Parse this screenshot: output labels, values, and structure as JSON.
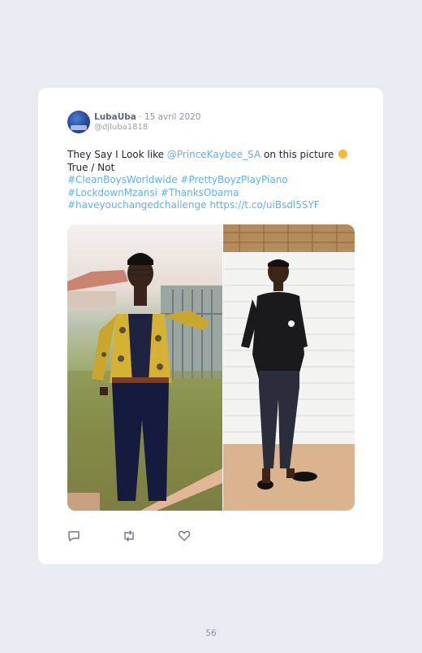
{
  "tweet": {
    "author_name": "LubaUba",
    "separator": " · ",
    "date": "15 avril 2020",
    "handle": "@djluba1818",
    "text_prefix": "They Say I Look like ",
    "mention": "@PrinceKaybee_SA",
    "text_suffix": " on this picture ",
    "line2": "True / Not",
    "hashtags_line1": "#CleanBoysWorldwide #PrettyBoyzPlayPiano",
    "hashtags_line2": "#LockdownMzansi #ThanksObama",
    "hashtags_line3_tags": "#haveyouchangedchallenge",
    "url": "https://t.co/uiBsdl5SYF"
  },
  "actions": {
    "reply_icon": "reply-icon",
    "retweet_icon": "retweet-icon",
    "like_icon": "heart-icon"
  },
  "page_number": "56",
  "colors": {
    "background": "#e9ebf2",
    "card": "#ffffff",
    "link": "#5fb0ea",
    "text": "#1d2330",
    "meta": "#8c93a6"
  }
}
